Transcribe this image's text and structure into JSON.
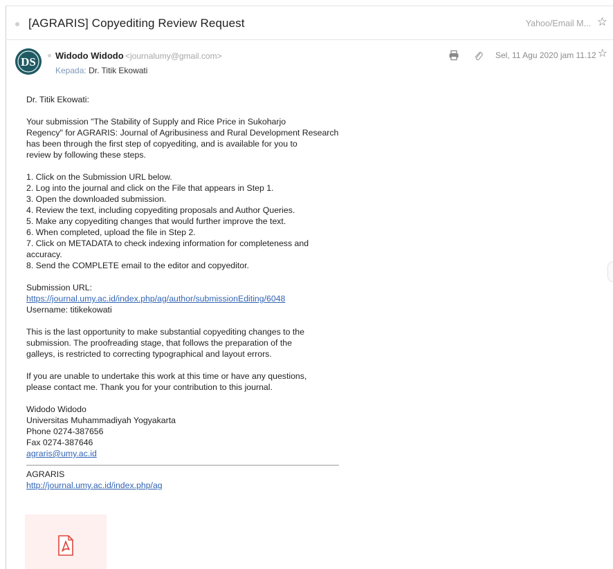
{
  "subject": {
    "title": "[AGRARIS] Copyediting Review Request",
    "folder": "Yahoo/Email M...",
    "star_icon": "star-outline-icon"
  },
  "message": {
    "sender_name": "Widodo Widodo",
    "sender_email": "<journalumy@gmail.com>",
    "to_label": "Kepada:",
    "to_value": "Dr. Titik Ekowati",
    "date": "Sel, 11 Agu 2020 jam 11.12",
    "avatar_text": "DS",
    "avatar_color": "#1f5a63"
  },
  "body": {
    "greeting": "Dr. Titik Ekowati:",
    "intro": [
      "Your submission \"The Stability of Supply and Rice Price in Sukoharjo",
      "Regency\" for AGRARIS: Journal of Agribusiness and Rural Development Research",
      "has been through the first step of copyediting, and is available for you to",
      "review by following these steps."
    ],
    "steps": [
      "1. Click on the Submission URL below.",
      "2. Log into the journal and click on the File that appears in Step 1.",
      "3. Open the downloaded submission.",
      "4. Review the text, including copyediting proposals and Author Queries.",
      "5. Make any copyediting changes that would further improve the text.",
      "6. When completed, upload the file in Step 2.",
      "7. Click on METADATA to check indexing information for completeness and",
      "accuracy.",
      "8. Send the COMPLETE email to the editor and copyeditor."
    ],
    "submission_url_label": "Submission URL:",
    "submission_url": "https://journal.umy.ac.id/index.php/ag/author/submissionEditing/6048",
    "username": "Username: titikekowati",
    "last_opportunity": [
      "This is the last opportunity to make substantial copyediting changes to the",
      "submission. The proofreading stage, that follows the preparation of the",
      "galleys, is restricted to correcting typographical and layout errors."
    ],
    "contact": [
      "If you are unable to undertake this work at this time or have any questions,",
      "please contact me. Thank you for your contribution to this journal."
    ],
    "signature": {
      "name": "Widodo Widodo",
      "university": "Universitas Muhammadiyah Yogyakarta",
      "phone": "Phone 0274-387656",
      "fax": "Fax 0274-387646",
      "email": "agraris@umy.ac.id"
    },
    "footer": {
      "journal": "AGRARIS",
      "url": "http://journal.umy.ac.id/index.php/ag"
    }
  },
  "attachment": {
    "icon": "pdf-icon",
    "bg_color": "#fdf0ee"
  }
}
